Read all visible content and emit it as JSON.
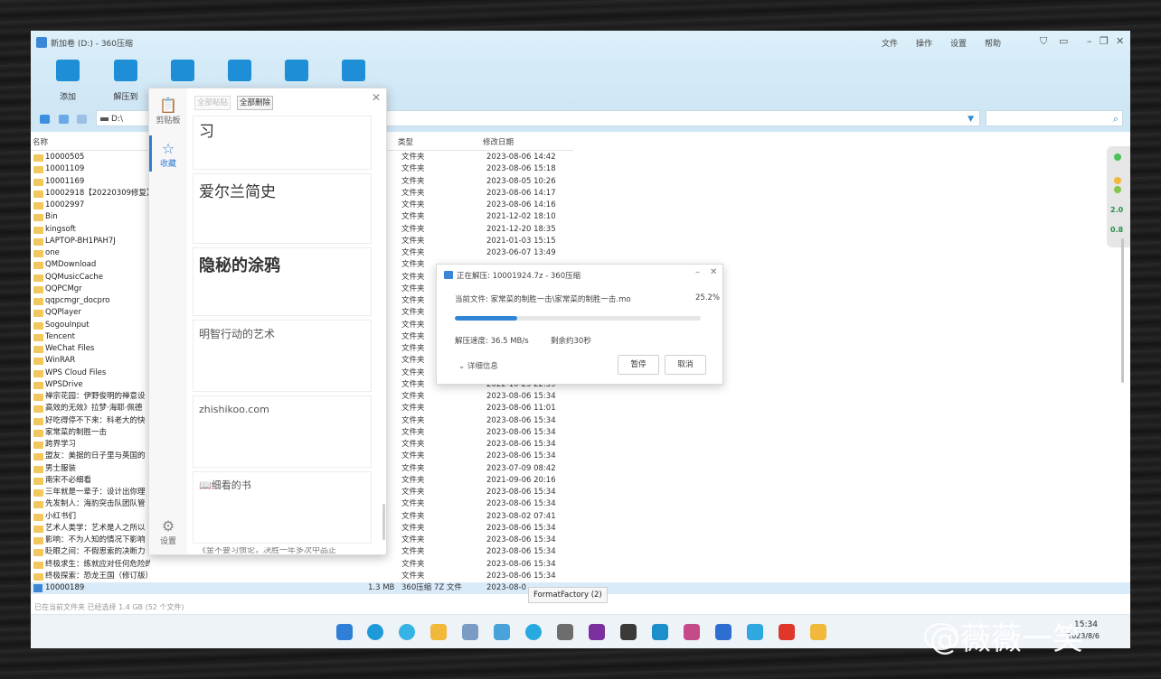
{
  "window": {
    "title": "新加卷 (D:) - 360压缩",
    "menu": [
      "文件",
      "操作",
      "设置",
      "帮助"
    ]
  },
  "toolbar": {
    "items": [
      "添加",
      "解压到",
      "",
      "",
      "",
      ""
    ]
  },
  "address": {
    "path": "D:\\"
  },
  "columns": {
    "name": "名称",
    "type": "类型",
    "modified": "修改日期"
  },
  "files": [
    {
      "name": "10000505",
      "type": "文件夹",
      "date": "2023-08-06 14:42"
    },
    {
      "name": "10001109",
      "type": "文件夹",
      "date": "2023-08-06 15:18"
    },
    {
      "name": "10001169",
      "type": "文件夹",
      "date": "2023-08-05 10:26"
    },
    {
      "name": "10002918【20220309修复】",
      "type": "文件夹",
      "date": "2023-08-06 14:17"
    },
    {
      "name": "10002997",
      "type": "文件夹",
      "date": "2023-08-06 14:16"
    },
    {
      "name": "Bin",
      "type": "文件夹",
      "date": "2021-12-02 18:10"
    },
    {
      "name": "kingsoft",
      "type": "文件夹",
      "date": "2021-12-20 18:35"
    },
    {
      "name": "LAPTOP-BH1PAH7J",
      "type": "文件夹",
      "date": "2021-01-03 15:15"
    },
    {
      "name": "one",
      "type": "文件夹",
      "date": "2023-06-07 13:49"
    },
    {
      "name": "QMDownload",
      "type": "文件夹",
      "date": ""
    },
    {
      "name": "QQMusicCache",
      "type": "文件夹",
      "date": ""
    },
    {
      "name": "QQPCMgr",
      "type": "文件夹",
      "date": ""
    },
    {
      "name": "qqpcmgr_docpro",
      "type": "文件夹",
      "date": ""
    },
    {
      "name": "QQPlayer",
      "type": "文件夹",
      "date": ""
    },
    {
      "name": "SogouInput",
      "type": "文件夹",
      "date": ""
    },
    {
      "name": "Tencent",
      "type": "文件夹",
      "date": ""
    },
    {
      "name": "WeChat Files",
      "type": "文件夹",
      "date": ""
    },
    {
      "name": "WinRAR",
      "type": "文件夹",
      "date": ""
    },
    {
      "name": "WPS Cloud Files",
      "type": "文件夹",
      "date": ""
    },
    {
      "name": "WPSDrive",
      "type": "文件夹",
      "date": "2022-10-25 22:39"
    },
    {
      "name": "禅宗花园：伊野俊明的禅意设",
      "type": "文件夹",
      "date": "2023-08-06 15:34"
    },
    {
      "name": "高效的无效》拉梦·海耶·佩德",
      "type": "文件夹",
      "date": "2023-08-06 11:01"
    },
    {
      "name": "好吃得停不下来：科老大的快",
      "type": "文件夹",
      "date": "2023-08-06 15:34"
    },
    {
      "name": "家常菜的制胜一击",
      "type": "文件夹",
      "date": "2023-08-06 15:34"
    },
    {
      "name": "跨界学习",
      "type": "文件夹",
      "date": "2023-08-06 15:34"
    },
    {
      "name": "盟友：美据的日子里与英国的",
      "type": "文件夹",
      "date": "2023-08-06 15:34"
    },
    {
      "name": "男士服装",
      "type": "文件夹",
      "date": "2023-07-09 08:42"
    },
    {
      "name": "南宋不必细看",
      "type": "文件夹",
      "date": "2021-09-06 20:16"
    },
    {
      "name": "三年就是一辈子：设计出你理",
      "type": "文件夹",
      "date": "2023-08-06 15:34"
    },
    {
      "name": "先发制人：海豹突击队团队管",
      "type": "文件夹",
      "date": "2023-08-06 15:34"
    },
    {
      "name": "小红书们",
      "type": "文件夹",
      "date": "2023-08-02 07:41"
    },
    {
      "name": "艺术人类学：艺术是人之所以",
      "type": "文件夹",
      "date": "2023-08-06 15:34"
    },
    {
      "name": "影响：不为人知的情况下影响",
      "type": "文件夹",
      "date": "2023-08-06 15:34"
    },
    {
      "name": "眨眼之间：不假思索的决断力",
      "type": "文件夹",
      "date": "2023-08-06 15:34"
    },
    {
      "name": "终极求生：练就应对任何危险的能力",
      "type": "文件夹",
      "date": "2023-08-06 15:34"
    },
    {
      "name": "终极探索：恐龙王国（修订版）",
      "type": "文件夹",
      "date": "2023-08-06 15:34"
    }
  ],
  "selected_file": {
    "name": "10000189",
    "size": "1.3 MB",
    "type": "360压缩 7Z 文件",
    "date": "2023-08-0"
  },
  "status": "已在当前文件夹 已经选择 1.4 GB (52 个文件)",
  "tooltip": "FormatFactory (2)",
  "side_widget": {
    "val1": "2.0",
    "val2": "0.8"
  },
  "clipboard": {
    "rail": {
      "clipboard": "剪贴板",
      "favorites": "收藏",
      "settings": "设置"
    },
    "buttons": {
      "paste_all": "全部粘贴",
      "clear_all": "全部删除"
    },
    "cards": [
      "习",
      "爱尔兰简史",
      "隐秘的涂鸦",
      "明智行动的艺术",
      "zhishikoo.com",
      "📖细看的书",
      "《金不要习惯论，决胜一年多次中品正"
    ]
  },
  "extract": {
    "title": "正在解压: 10001924.7z - 360压缩",
    "current_file": "当前文件: 家常菜的制胜一击\\家常菜的制胜一击.mo",
    "percent_text": "25.2%",
    "progress": 0.252,
    "speed": "解压速度: 36.5 MB/s",
    "remaining": "剩余约30秒",
    "details": "详细信息",
    "pause": "暂停",
    "cancel": "取消"
  },
  "taskbar": {
    "time": "15:34",
    "date": "2023/8/6"
  },
  "watermark": "@薇薇一笑"
}
